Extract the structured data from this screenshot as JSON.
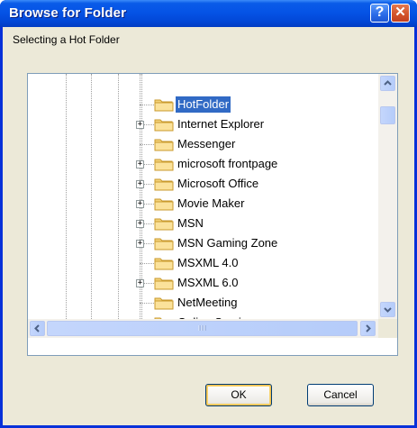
{
  "window": {
    "title": "Browse for Folder",
    "help_symbol": "?",
    "close_symbol": "✕"
  },
  "prompt": "Selecting a Hot Folder",
  "tree": {
    "items": [
      {
        "label": "HotFolder",
        "expandable": false,
        "selected": true
      },
      {
        "label": "Internet Explorer",
        "expandable": true,
        "selected": false
      },
      {
        "label": "Messenger",
        "expandable": false,
        "selected": false
      },
      {
        "label": "microsoft frontpage",
        "expandable": true,
        "selected": false
      },
      {
        "label": "Microsoft Office",
        "expandable": true,
        "selected": false
      },
      {
        "label": "Movie Maker",
        "expandable": true,
        "selected": false
      },
      {
        "label": "MSN",
        "expandable": true,
        "selected": false
      },
      {
        "label": "MSN Gaming Zone",
        "expandable": true,
        "selected": false
      },
      {
        "label": "MSXML 4.0",
        "expandable": false,
        "selected": false
      },
      {
        "label": "MSXML 6.0",
        "expandable": true,
        "selected": false
      },
      {
        "label": "NetMeeting",
        "expandable": false,
        "selected": false
      },
      {
        "label": "Online Services",
        "expandable": false,
        "selected": false
      }
    ],
    "vertical_scroll_fraction": 0.35
  },
  "buttons": {
    "ok": "OK",
    "cancel": "Cancel"
  }
}
